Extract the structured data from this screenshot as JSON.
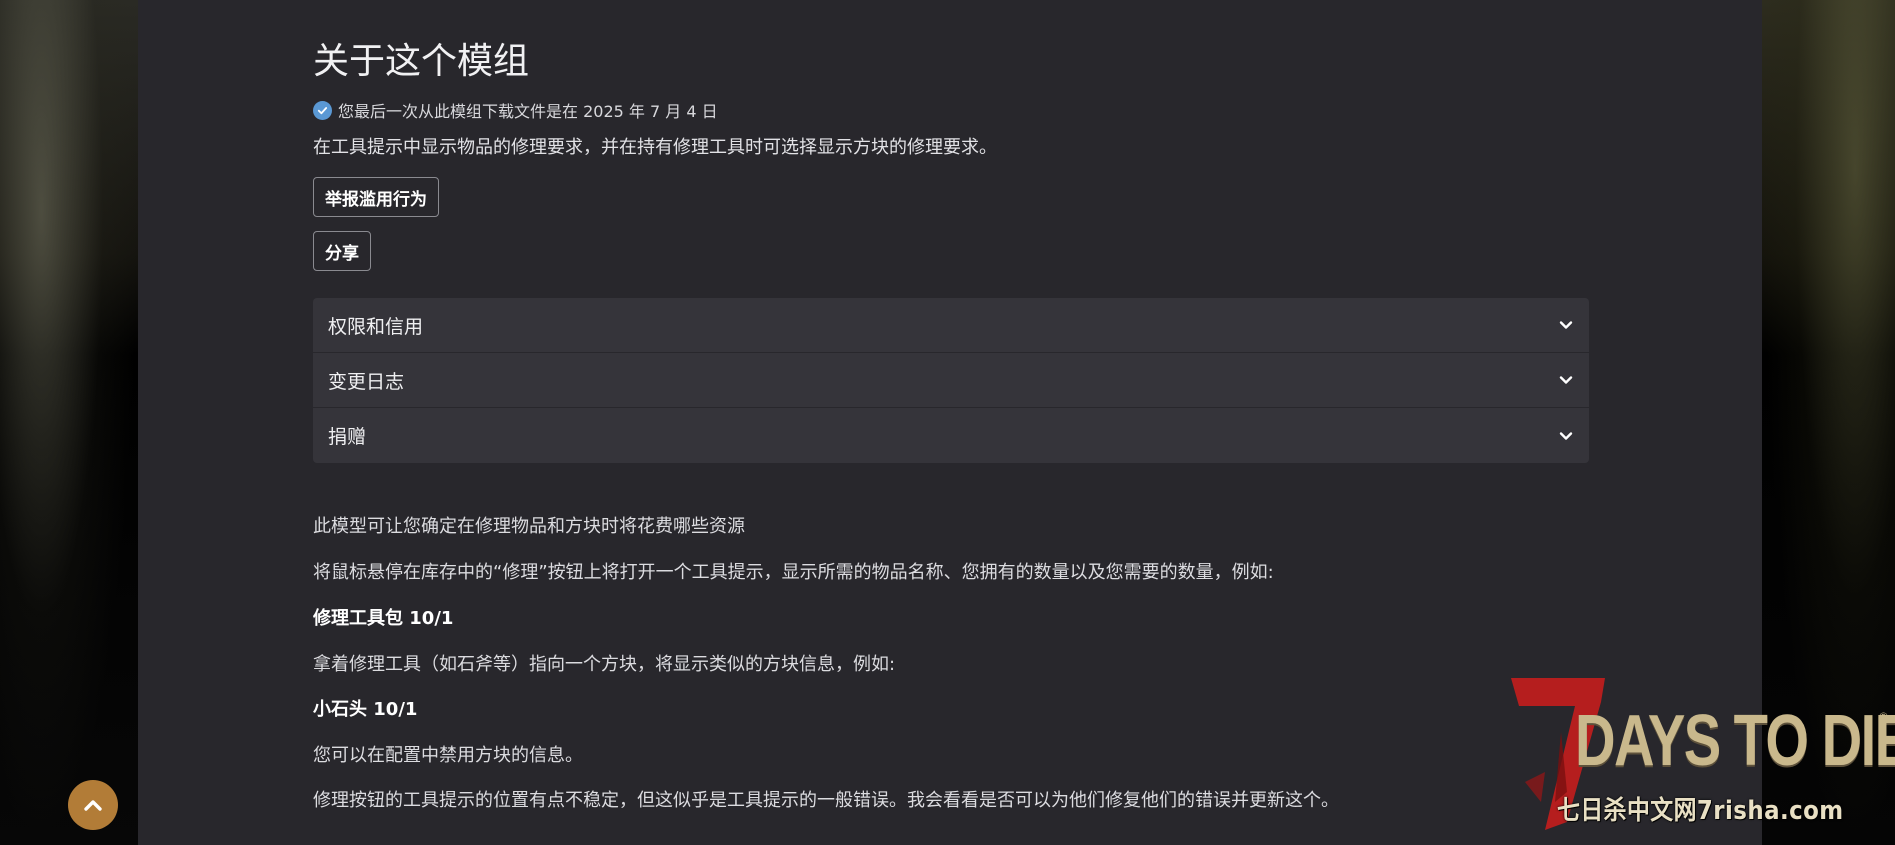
{
  "about": {
    "title": "关于这个模组",
    "download_notice": "您最后一次从此模组下载文件是在 2025 年 7 月 4 日",
    "summary": "在工具提示中显示物品的修理要求，并在持有修理工具时可选择显示方块的修理要求。"
  },
  "actions": {
    "report_label": "举报滥用行为",
    "share_label": "分享"
  },
  "accordion": {
    "items": [
      {
        "label": "权限和信用"
      },
      {
        "label": "变更日志"
      },
      {
        "label": "捐赠"
      }
    ]
  },
  "description": {
    "p1": "此模型可让您确定在修理物品和方块时将花费哪些资源",
    "p2": "将鼠标悬停在库存中的“修理”按钮上将打开一个工具提示，显示所需的物品名称、您拥有的数量以及您需要的数量，例如:",
    "p3": "修理工具包 10/1",
    "p4": "拿着修理工具（如石斧等）指向一个方块，将显示类似的方块信息，例如:",
    "p5": "小石头 10/1",
    "p6": "您可以在配置中禁用方块的信息。",
    "p7": "修理按钮的工具提示的位置有点不稳定，但这似乎是工具提示的一般错误。我会看看是否可以为他们修复他们的错误并更新这个。"
  },
  "watermark": {
    "logo_number": "7",
    "logo_text": "DAYS TO DIE",
    "registered": "®",
    "site_text": "七日杀中文网7risha.com"
  },
  "icons": {
    "check": "check-circle-icon",
    "chevron": "chevron-down-icon",
    "back_to_top": "chevron-up-icon"
  },
  "colors": {
    "panel_bg": "#28272c",
    "accordion_bg": "#35343a",
    "check_blue": "#5a98d4",
    "back_to_top": "#b27c37"
  }
}
